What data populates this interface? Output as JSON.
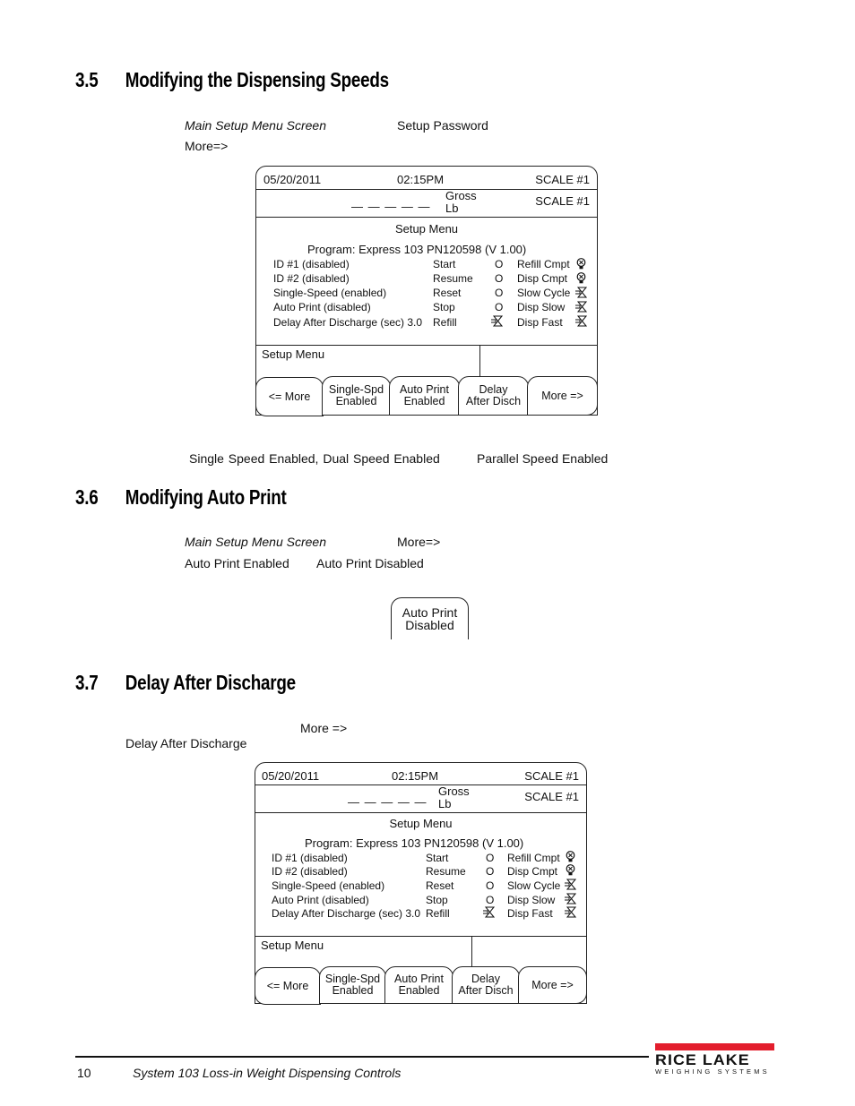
{
  "sections": [
    {
      "number": "3.5",
      "title": "Modifying the Dispensing Speeds",
      "lines": {
        "main_setup_menu_screen": "Main Setup Menu Screen",
        "setup_password": "Setup Password",
        "more": "More=>",
        "speed_options": "Single  Speed  Enabled,  Dual  Speed  Enabled",
        "parallel_option": "Parallel  Speed  Enabled"
      }
    },
    {
      "number": "3.6",
      "title": "Modifying Auto Print",
      "lines": {
        "main_setup_menu_screen": "Main Setup Menu Screen",
        "more": "More=>",
        "auto_print_enabled": "Auto Print Enabled",
        "auto_print_disabled": "Auto Print Disabled"
      },
      "button": {
        "line1": "Auto Print",
        "line2": "Disabled"
      }
    },
    {
      "number": "3.7",
      "title": "Delay After Discharge",
      "lines": {
        "more": "More =>",
        "delay_after_discharge": "Delay After Discharge"
      }
    }
  ],
  "screen": {
    "date": "05/20/2011",
    "time": "02:15PM",
    "scale_top": "SCALE #1",
    "gross": "Gross",
    "unit": "Lb",
    "weight_dashes": "— — — — —",
    "scale_mid": "SCALE #1",
    "menu_title": "Setup Menu",
    "program": "Program: Express 103 PN120598  (V 1.00)",
    "settings": [
      {
        "label": "ID #1 (disabled)",
        "io": "Start",
        "io_state": "O",
        "output": "Refill Cmpt",
        "output_icon": "lamp-icon"
      },
      {
        "label": "ID #2 (disabled)",
        "io": "Resume",
        "io_state": "O",
        "output": "Disp Cmpt",
        "output_icon": "lamp-icon"
      },
      {
        "label": "Single-Speed (enabled)",
        "io": "Reset",
        "io_state": "O",
        "output": "Slow Cycle",
        "output_icon": "valve-icon"
      },
      {
        "label": "Auto Print (disabled)",
        "io": "Stop",
        "io_state": "O",
        "output": "Disp Slow",
        "output_icon": "valve-icon"
      },
      {
        "label": "Delay After Discharge (sec) 3.0",
        "io": "Refill",
        "io_state": "valve",
        "output": "Disp Fast",
        "output_icon": "valve-icon"
      }
    ],
    "status_label": "Setup Menu",
    "softkeys": [
      {
        "line1": "<= More",
        "line2": ""
      },
      {
        "line1": "Single-Spd",
        "line2": "Enabled"
      },
      {
        "line1": "Auto Print",
        "line2": "Enabled"
      },
      {
        "line1": "Delay",
        "line2": "After Disch"
      },
      {
        "line1": "More =>",
        "line2": ""
      }
    ]
  },
  "footer": {
    "page_number": "10",
    "doc_title": "System 103 Loss-in Weight Dispensing Controls",
    "logo_main": "RICE LAKE",
    "logo_sub": "WEIGHING SYSTEMS",
    "logo_color": "#e31e2d"
  }
}
